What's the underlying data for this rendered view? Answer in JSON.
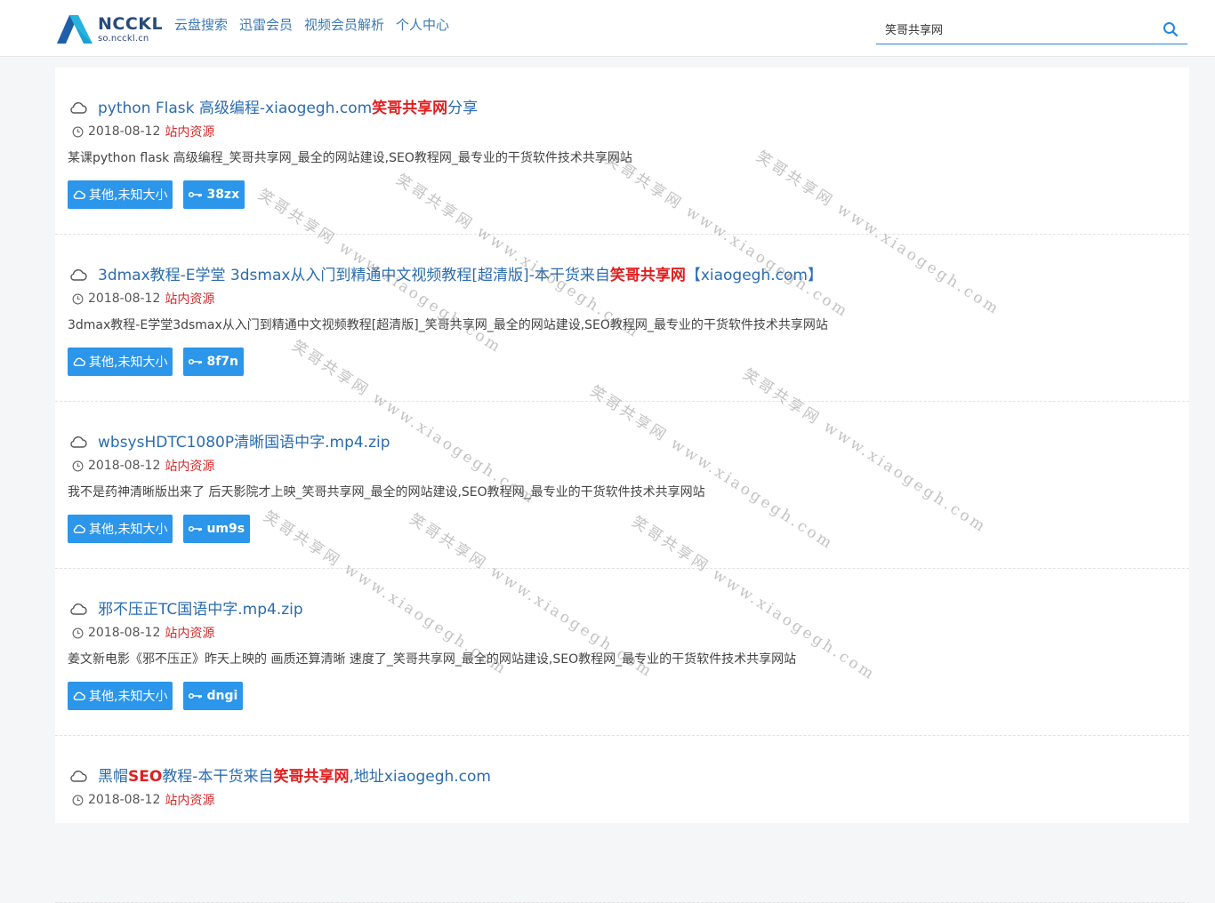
{
  "logo": {
    "title": "NCCKL",
    "subtitle": "so.ncckl.cn"
  },
  "nav": [
    "云盘搜索",
    "迅雷会员",
    "视频会员解析",
    "个人中心"
  ],
  "search": {
    "value": "笑哥共享网"
  },
  "watermark": "笑哥共享网 www.xiaogegh.com",
  "colors": {
    "accent": "#2b96ea",
    "highlight": "#e02020",
    "link": "#2b6cb0"
  },
  "items": [
    {
      "title_pre": "python Flask 高级编程-xiaogegh.com",
      "title_hl": "笑哥共享网",
      "title_post": "分享",
      "date": "2018-08-12",
      "source": "站内资源",
      "desc": "某课python flask 高级编程_笑哥共享网_最全的网站建设,SEO教程网_最专业的干货软件技术共享网站",
      "size": "其他,未知大小",
      "code": "38zx"
    },
    {
      "title_pre": "3dmax教程-E学堂 3dsmax从入门到精通中文视频教程[超清版]-本干货来自",
      "title_hl": "笑哥共享网",
      "title_post": "【xiaogegh.com】",
      "date": "2018-08-12",
      "source": "站内资源",
      "desc": "3dmax教程-E学堂3dsmax从入门到精通中文视频教程[超清版]_笑哥共享网_最全的网站建设,SEO教程网_最专业的干货软件技术共享网站",
      "size": "其他,未知大小",
      "code": "8f7n"
    },
    {
      "title_pre": "wbsysHDTC1080P清晰国语中字.mp4.zip",
      "title_hl": "",
      "title_post": "",
      "date": "2018-08-12",
      "source": "站内资源",
      "desc": "我不是药神清晰版出来了 后天影院才上映_笑哥共享网_最全的网站建设,SEO教程网_最专业的干货软件技术共享网站",
      "size": "其他,未知大小",
      "code": "um9s"
    },
    {
      "title_pre": "邪不压正TC国语中字.mp4.zip",
      "title_hl": "",
      "title_post": "",
      "date": "2018-08-12",
      "source": "站内资源",
      "desc": "姜文新电影《邪不压正》昨天上映的 画质还算清晰 速度了_笑哥共享网_最全的网站建设,SEO教程网_最专业的干货软件技术共享网站",
      "size": "其他,未知大小",
      "code": "dngi"
    },
    {
      "title_pre": "黑帽",
      "title_hl": "SEO",
      "title_mid": "教程-本干货来自",
      "title_hl2": "笑哥共享网",
      "title_post": ",地址xiaogegh.com",
      "date": "2018-08-12",
      "source": "站内资源",
      "desc": "",
      "size": "",
      "code": ""
    }
  ]
}
